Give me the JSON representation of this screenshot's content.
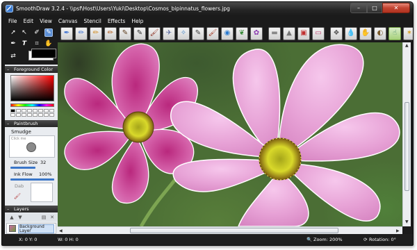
{
  "window": {
    "title": "SmoothDraw 3.2.4 - \\\\psf\\Host\\Users\\Yuki\\Desktop\\Cosmos_bipinnatus_flowers.jpg"
  },
  "menu": [
    "File",
    "Edit",
    "View",
    "Canvas",
    "Stencil",
    "Effects",
    "Help"
  ],
  "foreground_panel": {
    "title": "Foreground Color",
    "foreground_color": "#000000"
  },
  "paintbrush_panel": {
    "title": "Paintbrush",
    "brush_name": "Smudge",
    "preview_hint": "Click me",
    "brush_size_label": "Brush Size",
    "brush_size_value": "32",
    "ink_flow_label": "Ink Flow",
    "ink_flow_value": "100%",
    "dab_label": "Dab"
  },
  "layers_panel": {
    "title": "Layers",
    "layer_name": "Background Layer"
  },
  "brushes": [
    {
      "icon": "pen-icon",
      "glyph": "✒"
    },
    {
      "icon": "pencil-icon",
      "glyph": "✏"
    },
    {
      "icon": "chalk-icon",
      "glyph": "✏"
    },
    {
      "icon": "crayon-icon",
      "glyph": "✏"
    },
    {
      "icon": "charcoal-icon",
      "glyph": "✎"
    },
    {
      "icon": "marker-icon",
      "glyph": "✎"
    },
    {
      "icon": "brush-icon",
      "glyph": "🖌"
    },
    {
      "icon": "airbrush-icon",
      "glyph": "✈"
    },
    {
      "icon": "spray-icon",
      "glyph": "✧"
    },
    {
      "icon": "pencil-icon",
      "glyph": "✎"
    },
    {
      "icon": "oil-brush-icon",
      "glyph": "🖌"
    },
    {
      "icon": "blur-icon",
      "glyph": "◉"
    },
    {
      "icon": "grass-icon",
      "glyph": "❦"
    },
    {
      "icon": "flower-brush-icon",
      "glyph": "✿"
    },
    {
      "icon": "block-icon",
      "glyph": "▬"
    },
    {
      "icon": "shape-icon",
      "glyph": "▲"
    },
    {
      "icon": "stamp-icon",
      "glyph": "▣"
    },
    {
      "icon": "eraser-icon",
      "glyph": "▭"
    },
    {
      "icon": "pattern-icon",
      "glyph": "❖"
    },
    {
      "icon": "water-drop-icon",
      "glyph": "💧"
    },
    {
      "icon": "smudge-icon",
      "glyph": "✋"
    },
    {
      "icon": "dodge-icon",
      "glyph": "◐"
    },
    {
      "icon": "smudge-brush-icon",
      "glyph": "☝"
    },
    {
      "icon": "sparkle-icon",
      "glyph": "✶"
    }
  ],
  "colors": {
    "selected_brush": "#a6d07a",
    "window_chrome": "#1b1b1b",
    "close_button": "#c24431",
    "flower_pink": "#e7a2d6"
  },
  "status": {
    "coords": "X: 0 Y: 0",
    "size": "W: 0 H: 0",
    "zoom": "Zoom: 200%",
    "rotation": "Rotation: 0°"
  }
}
